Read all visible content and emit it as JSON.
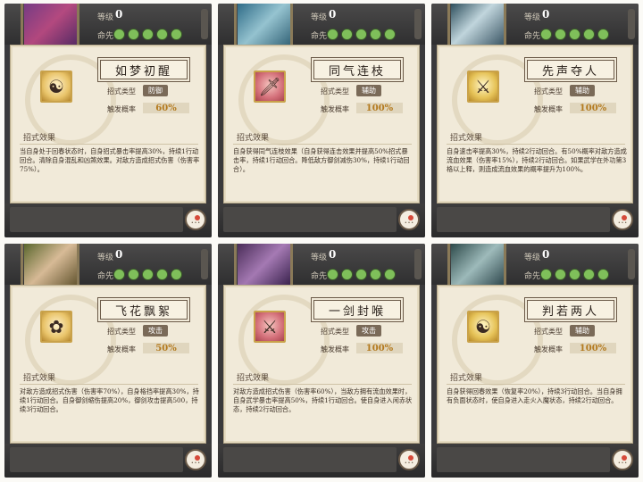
{
  "common": {
    "level_label": "等级",
    "level_value": "0",
    "attr_label": "命先",
    "type_label": "招式类型",
    "rate_label": "触发概率",
    "effect_label": "招式效果"
  },
  "panels": [
    {
      "name": "如梦初醒",
      "icon": "meditating-figure-icon",
      "type": "防御",
      "rate": "60%",
      "desc": "当自身处于回春状态时，自身招式暴击率提高30%，持续1行动回合。清除自身混乱和凶煞效果。对敌方造成招式伤害（伤害率75%）。"
    },
    {
      "name": "同气连枝",
      "icon": "sword-icon",
      "type": "辅助",
      "rate": "100%",
      "desc": "自身获得同气连枝效果（自身获得连击效果并提高50%招式暴击率，持续1行动回合。降低敌方御剑减伤30%，持续1行动回合）。"
    },
    {
      "name": "先声夺人",
      "icon": "warrior-icon",
      "type": "辅助",
      "rate": "100%",
      "desc": "自身速击率提高30%，持续2行动回合。有50%概率对敌方造成流血效果（伤害率15%），持续2行动回合。如果武学在外功第3格以上释，则造成流血效果的概率提升为100%。"
    },
    {
      "name": "飞花飘絮",
      "icon": "flying-flower-icon",
      "type": "攻击",
      "rate": "50%",
      "desc": "对敌方造成招式伤害（伤害率70%），自身格挡率提高30%，持续1行动回合。自身御剑缩伤提高20%，御剑攻击提高500，持续3行动回合。"
    },
    {
      "name": "一剑封喉",
      "icon": "swordsman-icon",
      "type": "攻击",
      "rate": "100%",
      "desc": "对敌方造成招式伤害（伤害率60%），当敌方拥有流血效果时，自身武学暴击率提高50%，持续1行动回合。使自身进入闲赤状态，持续2行动回合。"
    },
    {
      "name": "判若两人",
      "icon": "twin-figures-icon",
      "type": "辅助",
      "rate": "100%",
      "desc": "自身获得回春效果（恢复率20%），持续3行动回合。当自身拥有负面状态时，使自身进入走火入魔状态，持续2行动回合。"
    }
  ]
}
